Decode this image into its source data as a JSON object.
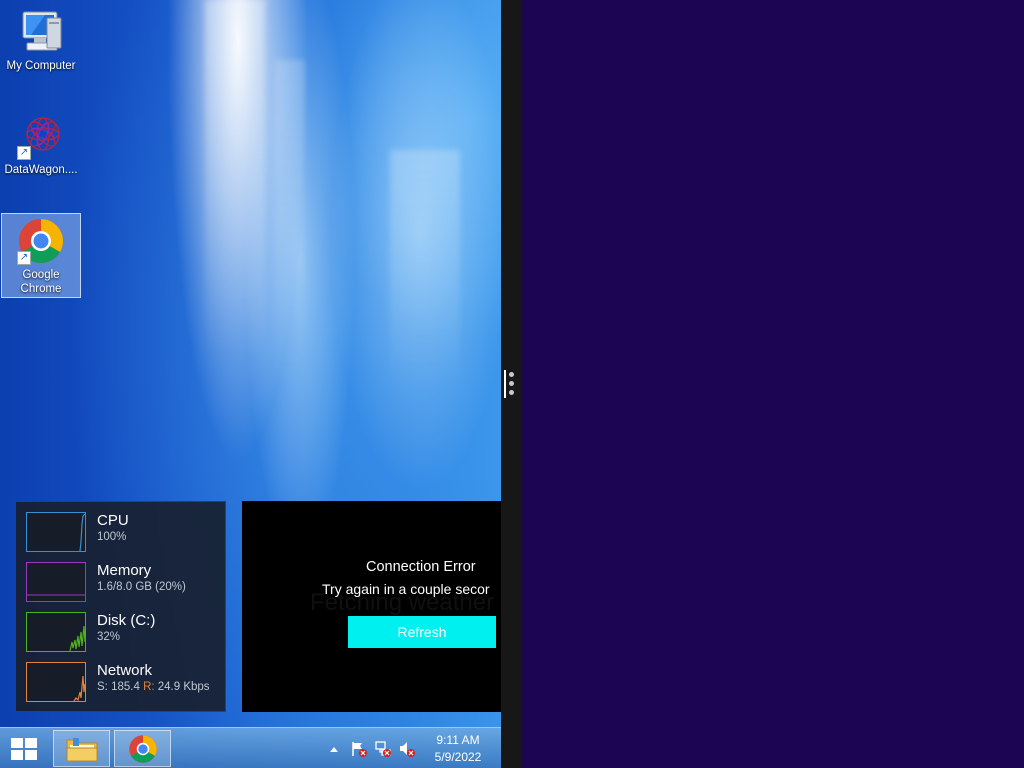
{
  "desktop": {
    "icons": [
      {
        "label": "My Computer",
        "icon": "my-computer-icon"
      },
      {
        "label": "DataWagon....",
        "icon": "datawagon-icon"
      },
      {
        "label": "Google Chrome",
        "icon": "chrome-icon",
        "selected": true
      }
    ]
  },
  "sysmon": {
    "cpu": {
      "title": "CPU",
      "value": "100%",
      "color": "#3a8fd0"
    },
    "memory": {
      "title": "Memory",
      "value": "1.6/8.0 GB (20%)",
      "color": "#9a3ab8"
    },
    "disk": {
      "title": "Disk (C:)",
      "value": "32%",
      "color": "#4fb020"
    },
    "network": {
      "title": "Network",
      "send_label": "S:",
      "send_value": "185.4",
      "recv_label": "R:",
      "recv_value": "24.9 Kbps",
      "color": "#e2833a"
    }
  },
  "weather": {
    "title": "Connection Error",
    "message": "Try again in a couple secor",
    "ghost_text": "Fetching weather",
    "refresh_label": "Refresh",
    "button_color": "#00f0f0"
  },
  "taskbar": {
    "pinned": [
      {
        "name": "file-explorer",
        "icon": "folder-icon"
      },
      {
        "name": "google-chrome",
        "icon": "chrome-icon"
      }
    ],
    "tray": {
      "overflow_icon": "up-arrow-icon",
      "icons": [
        "action-center-flag-icon",
        "network-disconnected-icon",
        "volume-muted-icon"
      ]
    },
    "clock": {
      "time": "9:11 AM",
      "date": "5/9/2022"
    }
  },
  "colors": {
    "right_pane_background": "#1c0552",
    "splitter": "#171717"
  }
}
